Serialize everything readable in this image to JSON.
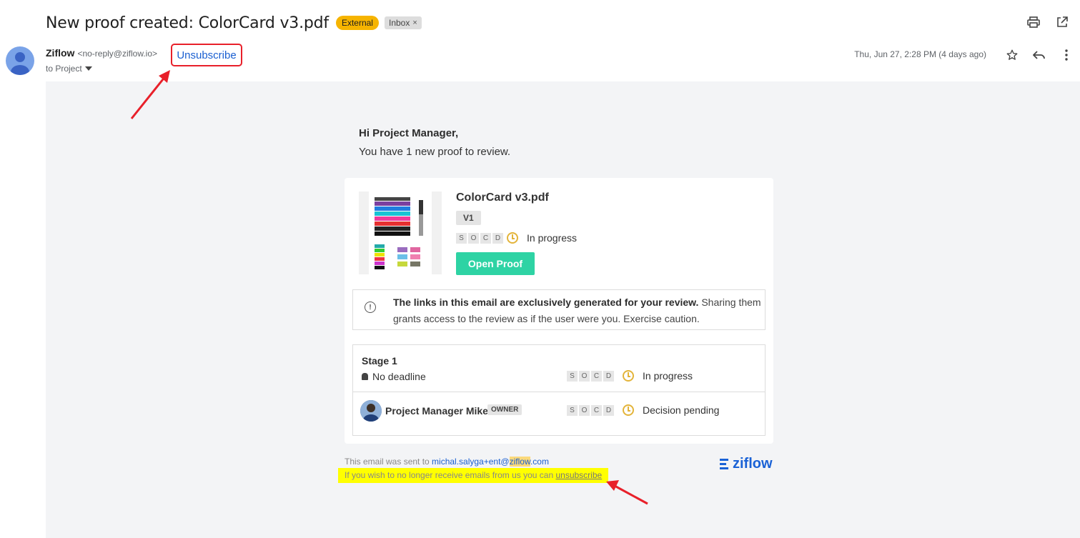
{
  "header": {
    "subject": "New proof created: ColorCard v3.pdf",
    "labels": {
      "external": "External",
      "inbox": "Inbox",
      "inbox_remove": "×"
    }
  },
  "sender": {
    "name": "Ziflow",
    "email": "<no-reply@ziflow.io>",
    "unsubscribe": "Unsubscribe",
    "to": "to Project",
    "date": "Thu, Jun 27, 2:28 PM (4 days ago)"
  },
  "email": {
    "greeting": "Hi Project Manager,",
    "intro": "You have 1 new proof to review.",
    "proof": {
      "file_name": "ColorCard v3.pdf",
      "version": "V1",
      "status": "In progress",
      "open_button": "Open Proof"
    },
    "socd": [
      "S",
      "O",
      "C",
      "D"
    ],
    "notice": {
      "bold": "The links in this email are exclusively generated for your review.",
      "rest": " Sharing them grants access to the review as if the user were you. Exercise caution."
    },
    "stage": {
      "title": "Stage 1",
      "deadline": "No deadline",
      "status": "In progress",
      "member": {
        "name": "Project Manager Mike",
        "role": "OWNER",
        "status": "Decision pending"
      }
    },
    "footer": {
      "sent_prefix": "This email was sent to ",
      "sent_email_a": "michal.salyga+ent@",
      "sent_email_hl": "ziflow",
      "sent_email_b": ".com",
      "unsub_text": "If you wish to no longer receive emails from us you can ",
      "unsub_link": "unsubscribe",
      "brand": "ziflow"
    }
  },
  "colors": {
    "highlight": "#ffff00",
    "annotation": "#e8202a",
    "open_proof": "#2ed3a4",
    "link": "#1a5fd1"
  }
}
